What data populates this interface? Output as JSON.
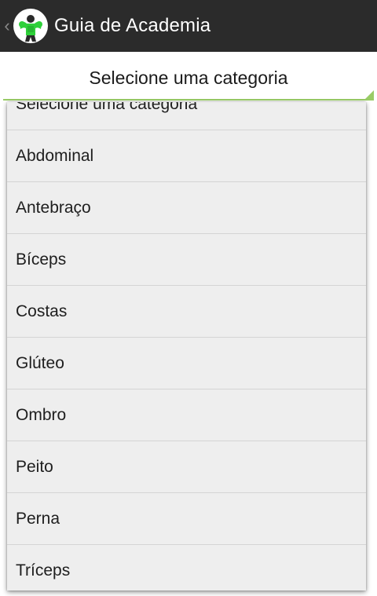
{
  "app": {
    "title": "Guia de Academia",
    "logo_icon": "bodybuilder-logo-icon",
    "up_icon": "back-caret-icon"
  },
  "spinner": {
    "selected": "Selecione uma categoria",
    "accent_color": "#99cc66"
  },
  "dropdown": {
    "options": [
      "Selecione uma categoria",
      "Abdominal",
      "Antebraço",
      "Bíceps",
      "Costas",
      "Glúteo",
      "Ombro",
      "Peito",
      "Perna",
      "Tríceps"
    ]
  }
}
